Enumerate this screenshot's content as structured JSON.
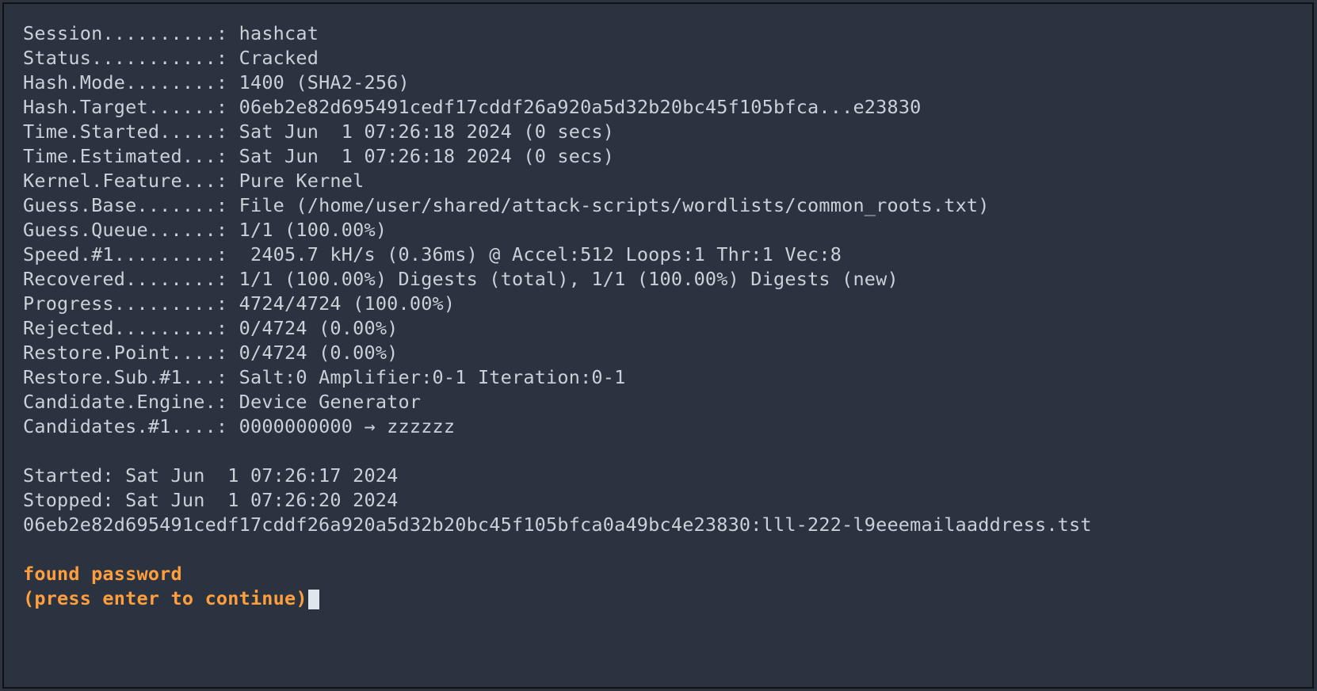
{
  "fields": {
    "session": {
      "label": "Session..........:",
      "value": "hashcat"
    },
    "status": {
      "label": "Status...........:",
      "value": "Cracked"
    },
    "hash_mode": {
      "label": "Hash.Mode........:",
      "value": "1400 (SHA2-256)"
    },
    "hash_target": {
      "label": "Hash.Target......:",
      "value": "06eb2e82d695491cedf17cddf26a920a5d32b20bc45f105bfca...e23830"
    },
    "time_started": {
      "label": "Time.Started.....:",
      "value": "Sat Jun  1 07:26:18 2024 (0 secs)"
    },
    "time_estimated": {
      "label": "Time.Estimated...:",
      "value": "Sat Jun  1 07:26:18 2024 (0 secs)"
    },
    "kernel_feature": {
      "label": "Kernel.Feature...:",
      "value": "Pure Kernel"
    },
    "guess_base": {
      "label": "Guess.Base.......:",
      "value": "File (/home/user/shared/attack-scripts/wordlists/common_roots.txt)"
    },
    "guess_queue": {
      "label": "Guess.Queue......:",
      "value": "1/1 (100.00%)"
    },
    "speed": {
      "label": "Speed.#1.........:",
      "value": " 2405.7 kH/s (0.36ms) @ Accel:512 Loops:1 Thr:1 Vec:8"
    },
    "recovered": {
      "label": "Recovered........:",
      "value": "1/1 (100.00%) Digests (total), 1/1 (100.00%) Digests (new)"
    },
    "progress": {
      "label": "Progress.........:",
      "value": "4724/4724 (100.00%)"
    },
    "rejected": {
      "label": "Rejected.........:",
      "value": "0/4724 (0.00%)"
    },
    "restore_point": {
      "label": "Restore.Point....:",
      "value": "0/4724 (0.00%)"
    },
    "restore_sub": {
      "label": "Restore.Sub.#1...:",
      "value": "Salt:0 Amplifier:0-1 Iteration:0-1"
    },
    "candidate_engine": {
      "label": "Candidate.Engine.:",
      "value": "Device Generator"
    },
    "candidates": {
      "label": "Candidates.#1....:",
      "value": "0000000000 → zzzzzz"
    }
  },
  "footer": {
    "started": "Started: Sat Jun  1 07:26:17 2024",
    "stopped": "Stopped: Sat Jun  1 07:26:20 2024",
    "hashline": "06eb2e82d695491cedf17cddf26a920a5d32b20bc45f105bfca0a49bc4e23830:lll-222-l9eeemailaaddress.tst"
  },
  "prompt": {
    "found": "found password",
    "continue": "(press enter to continue)"
  }
}
